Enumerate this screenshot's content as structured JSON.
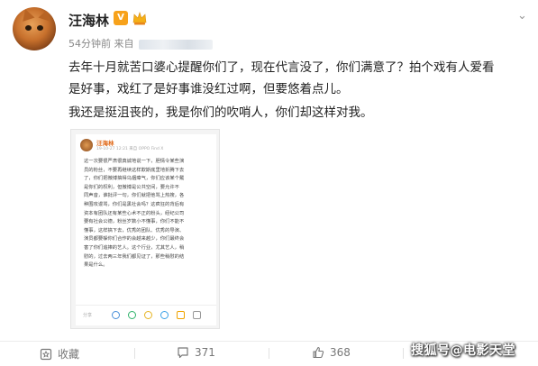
{
  "post": {
    "username": "汪海林",
    "badge_v": "V",
    "time": "54分钟前",
    "source_prefix": "来自",
    "lines": [
      "去年十月就苦口婆心提醒你们了，现在代言没了，你们满意了？拍个戏有人爱看",
      "是好事，戏红了是好事谁没红过啊，但要悠着点儿。",
      "我还是挺沮丧的，我是你们的吹哨人，你们却这样对我。"
    ]
  },
  "screenshot": {
    "username": "汪海林",
    "meta": "19-10-27 12:21   来自 OPPO Find X",
    "lines": [
      "这一次要很严肃很真诚地说一下，胆情令某些演",
      "员的粉丝，不要再继续这样欺斯底里地折腾下去",
      "了，你们把微博搞得乌烟瘴气，你们应该某个戴",
      "是你们的权利，但微博是公共空间，要允许不",
      "同声音，谁批评一句，你们就把他骂上热搜，各",
      "种围攻谩骂，你们是黑社会吗？这疯狂的背后有",
      "资本有团队还有某些心术不正的粉头，经纪公司",
      "要有社会公德，粉丝岁数小不懂事，你们不能不",
      "懂事，这样搞下去，优秀的团队、优秀的导演、",
      "演员都要躲你们合作的会越来越少，你们最终会",
      "害了你们追捧的艺人。这个行业，尤其艺人，稍",
      "慰的，过去两三年我们都见证了，那些稍慰的结",
      "果是什么。"
    ],
    "share_label": "分享"
  },
  "actions": {
    "forward": "收藏",
    "comments": "371",
    "likes": "368"
  },
  "watermark": "搜狐号@电影天堂",
  "colors": {
    "accent_orange": "#f7a21b",
    "text": "#222222",
    "meta": "#888888"
  }
}
